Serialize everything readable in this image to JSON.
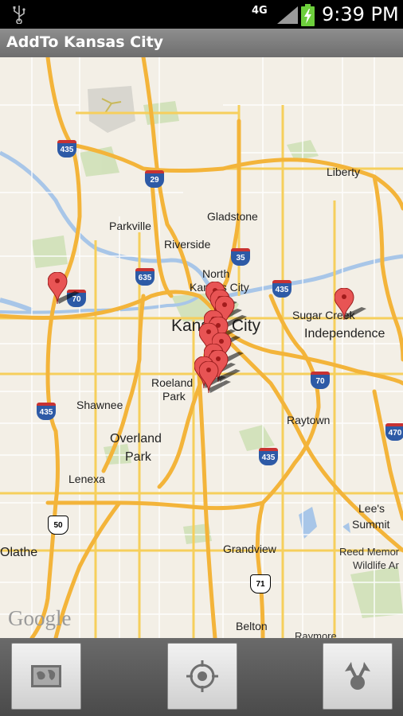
{
  "status_bar": {
    "network": "4G",
    "time": "9:39 PM"
  },
  "app": {
    "title": "AddTo Kansas City"
  },
  "map": {
    "labels": {
      "liberty": "Liberty",
      "gladstone": "Gladstone",
      "parkville": "Parkville",
      "riverside": "Riverside",
      "north_kansas_city_1": "North",
      "north_kansas_city_2": "Kansas City",
      "kansas_city": "Kansas City",
      "sugar_creek": "Sugar Creek",
      "independence": "Independence",
      "roeland_park_1": "Roeland",
      "roeland_park_2": "Park",
      "shawnee": "Shawnee",
      "overland_park_1": "Overland",
      "overland_park_2": "Park",
      "raytown": "Raytown",
      "lenexa": "Lenexa",
      "lees_summit_1": "Lee's",
      "lees_summit_2": "Summit",
      "olathe": "Olathe",
      "grandview": "Grandview",
      "reed_1": "Reed Memor",
      "reed_2": "Wildlife Ar",
      "belton": "Belton",
      "raymore": "Raymore"
    },
    "shields": {
      "i435_nw": "435",
      "i29": "29",
      "i635": "635",
      "i35": "35",
      "i435_ne": "435",
      "i70_w": "70",
      "i70_e": "70",
      "i435_sw": "435",
      "i435_se": "435",
      "i470": "470",
      "us50": "50",
      "us71": "71"
    },
    "attribution": "Google"
  },
  "toolbar": {
    "map_view_icon": "map-icon",
    "my_location_icon": "my-location-icon",
    "share_icon": "share-icon"
  }
}
